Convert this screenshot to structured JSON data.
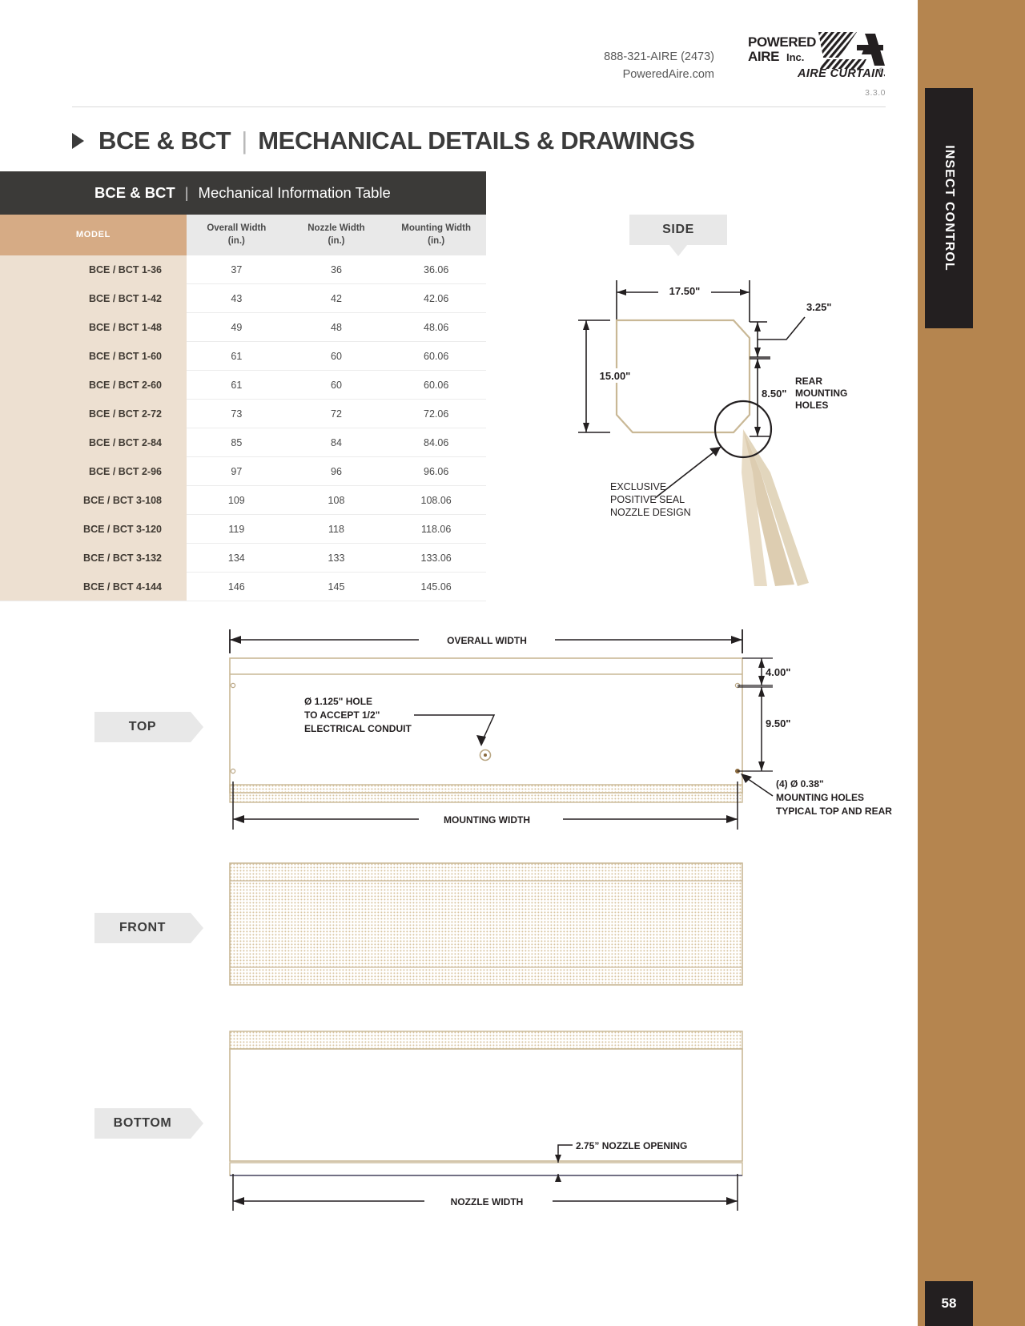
{
  "header": {
    "phone": "888-321-AIRE (2473)",
    "website": "PoweredAire.com",
    "version": "3.3.0",
    "logo_line1": "POWERED",
    "logo_line2": "AIRE Inc.",
    "logo_line3": "AIRE CURTAINS"
  },
  "page_title": {
    "model": "BCE & BCT",
    "divider": "|",
    "subject": "MECHANICAL DETAILS & DRAWINGS"
  },
  "side_rail": {
    "category": "INSECT CONTROL",
    "page_number": "58"
  },
  "table": {
    "title_model": "BCE & BCT",
    "title_divider": "|",
    "title_text": "Mechanical Information Table",
    "columns": [
      "MODEL",
      "Overall Width\n(in.)",
      "Nozzle Width\n(in.)",
      "Mounting Width\n(in.)"
    ],
    "column_headers": [
      {
        "line1": "MODEL",
        "line2": ""
      },
      {
        "line1": "Overall Width",
        "line2": "(in.)"
      },
      {
        "line1": "Nozzle Width",
        "line2": "(in.)"
      },
      {
        "line1": "Mounting Width",
        "line2": "(in.)"
      }
    ],
    "rows": [
      {
        "model": "BCE / BCT 1-36",
        "overall": "37",
        "nozzle": "36",
        "mounting": "36.06"
      },
      {
        "model": "BCE / BCT 1-42",
        "overall": "43",
        "nozzle": "42",
        "mounting": "42.06"
      },
      {
        "model": "BCE / BCT 1-48",
        "overall": "49",
        "nozzle": "48",
        "mounting": "48.06"
      },
      {
        "model": "BCE / BCT 1-60",
        "overall": "61",
        "nozzle": "60",
        "mounting": "60.06"
      },
      {
        "model": "BCE / BCT 2-60",
        "overall": "61",
        "nozzle": "60",
        "mounting": "60.06"
      },
      {
        "model": "BCE / BCT 2-72",
        "overall": "73",
        "nozzle": "72",
        "mounting": "72.06"
      },
      {
        "model": "BCE / BCT 2-84",
        "overall": "85",
        "nozzle": "84",
        "mounting": "84.06"
      },
      {
        "model": "BCE / BCT 2-96",
        "overall": "97",
        "nozzle": "96",
        "mounting": "96.06"
      },
      {
        "model": "BCE / BCT 3-108",
        "overall": "109",
        "nozzle": "108",
        "mounting": "108.06"
      },
      {
        "model": "BCE / BCT 3-120",
        "overall": "119",
        "nozzle": "118",
        "mounting": "118.06"
      },
      {
        "model": "BCE / BCT 3-132",
        "overall": "134",
        "nozzle": "133",
        "mounting": "133.06"
      },
      {
        "model": "BCE / BCT 4-144",
        "overall": "146",
        "nozzle": "145",
        "mounting": "145.06"
      }
    ]
  },
  "views": {
    "side": {
      "label": "SIDE",
      "dim_width": "17.50\"",
      "dim_height": "15.00\"",
      "dim_top_offset": "3.25\"",
      "dim_bottom_offset": "8.50\"",
      "note_rear_mounting": "REAR\nMOUNTING\nHOLES",
      "note_rear_line1": "REAR",
      "note_rear_line2": "MOUNTING",
      "note_rear_line3": "HOLES",
      "note_nozzle_line1": "EXCLUSIVE",
      "note_nozzle_line2": "POSITIVE SEAL",
      "note_nozzle_line3": "NOZZLE DESIGN"
    },
    "top": {
      "label": "TOP",
      "dim_overall_width": "OVERALL WIDTH",
      "dim_mounting_width": "MOUNTING WIDTH",
      "dim_4": "4.00\"",
      "dim_9_5": "9.50\"",
      "note_conduit_line1": "Ø 1.125\" HOLE",
      "note_conduit_line2": "TO ACCEPT 1/2\"",
      "note_conduit_line3": "ELECTRICAL CONDUIT",
      "note_holes_line1": "(4) Ø 0.38\"",
      "note_holes_line2": "MOUNTING HOLES",
      "note_holes_line3": "TYPICAL TOP AND REAR"
    },
    "front": {
      "label": "FRONT"
    },
    "bottom": {
      "label": "BOTTOM",
      "note_nozzle_opening": "2.75” NOZZLE OPENING",
      "dim_nozzle_width": "NOZZLE WIDTH"
    }
  },
  "colors": {
    "tan_rail": "#b5854f",
    "dark_header": "#3b3a38",
    "model_header": "#d6ab85",
    "model_cell": "#ede0d1",
    "drawing_line": "#c9b896",
    "black": "#231f20"
  }
}
